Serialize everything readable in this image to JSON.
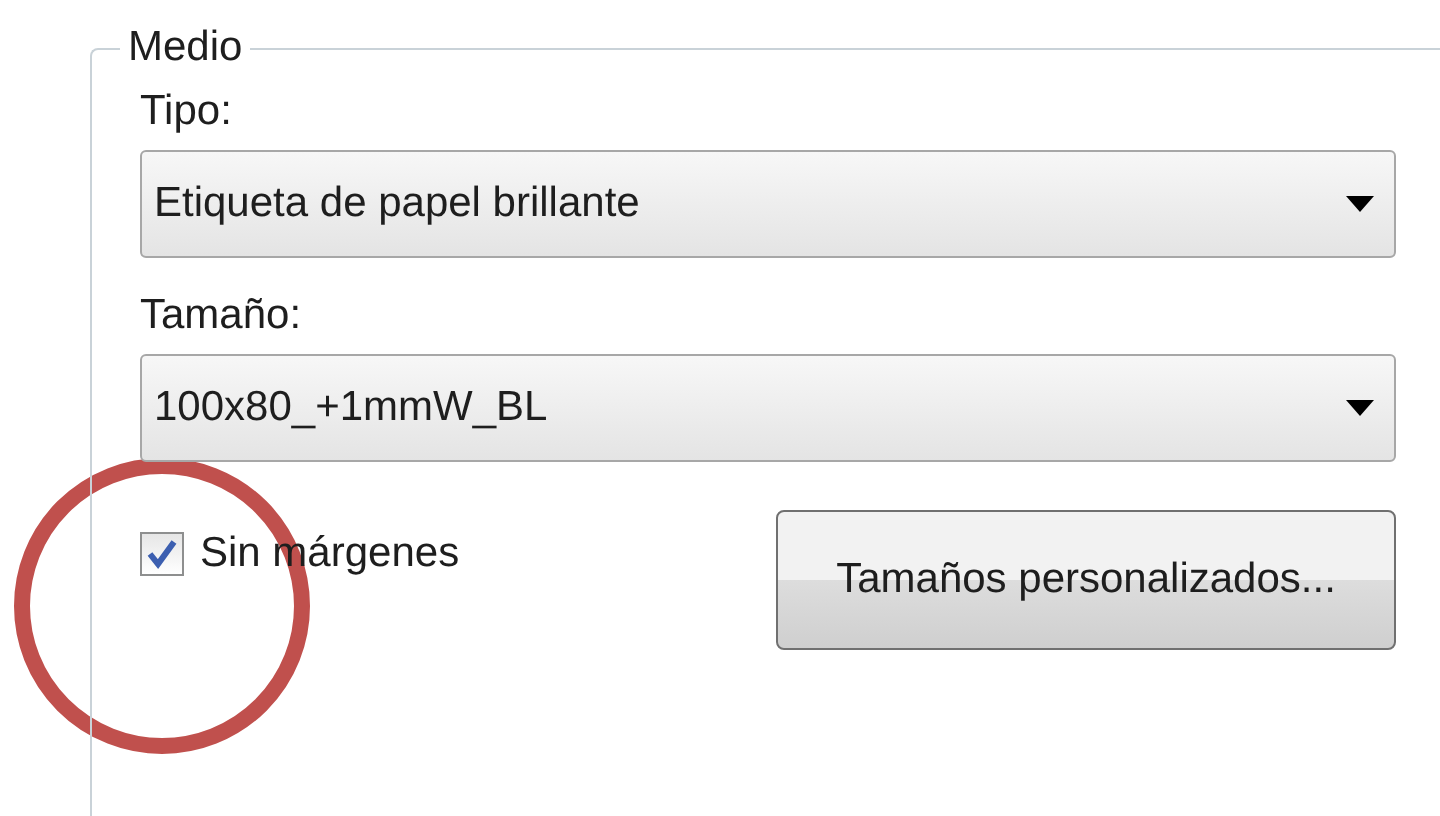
{
  "group": {
    "title": "Medio"
  },
  "fields": [
    {
      "label": "Tipo:",
      "value": "Etiqueta de papel brillante"
    },
    {
      "label": "Tamaño:",
      "value": "100x80_+1mmW_BL"
    }
  ],
  "borderless": {
    "label": "Sin márgenes",
    "checked": true
  },
  "custom_sizes_button": {
    "label": "Tamaños personalizados..."
  }
}
